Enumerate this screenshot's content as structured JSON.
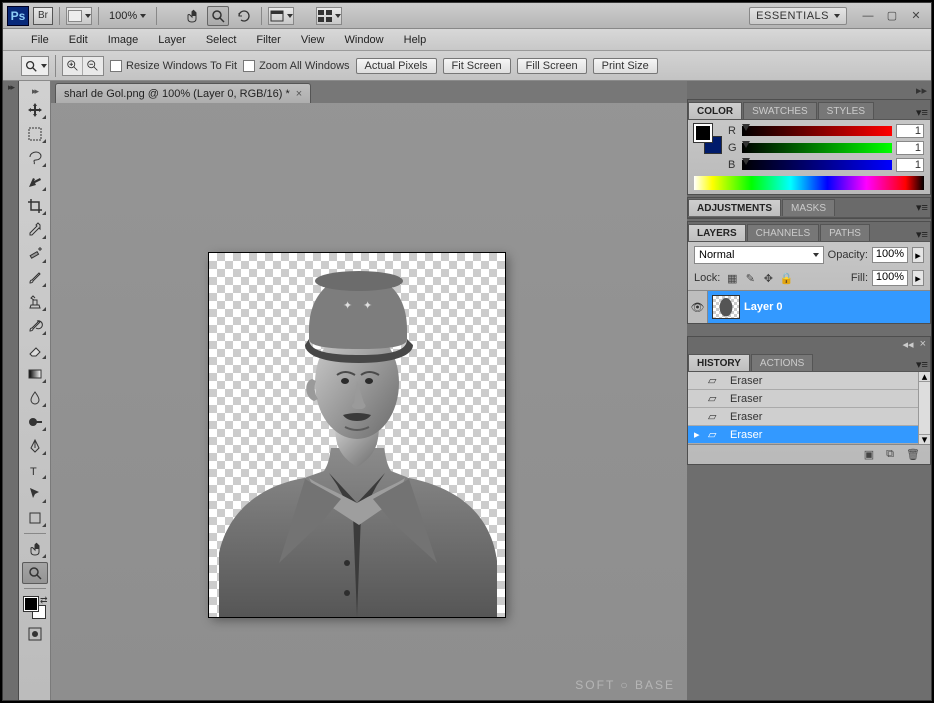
{
  "titlebar": {
    "ps_label": "Ps",
    "br_label": "Br",
    "zoom_value": "100%",
    "essentials_label": "ESSENTIALS"
  },
  "menu": {
    "items": [
      "File",
      "Edit",
      "Image",
      "Layer",
      "Select",
      "Filter",
      "View",
      "Window",
      "Help"
    ]
  },
  "optionsbar": {
    "resize_label": "Resize Windows To Fit",
    "zoom_all_label": "Zoom All Windows",
    "buttons": {
      "actual": "Actual Pixels",
      "fit": "Fit Screen",
      "fill": "Fill Screen",
      "print": "Print Size"
    }
  },
  "document": {
    "tab_title": "sharl de Gol.png @ 100% (Layer 0, RGB/16) *"
  },
  "panels": {
    "color": {
      "tab_color": "COLOR",
      "tab_swatches": "SWATCHES",
      "tab_styles": "STYLES",
      "r_label": "R",
      "g_label": "G",
      "b_label": "B",
      "r_value": "1",
      "g_value": "1",
      "b_value": "1"
    },
    "adjustments": {
      "tab_adjustments": "ADJUSTMENTS",
      "tab_masks": "MASKS"
    },
    "layers": {
      "tab_layers": "LAYERS",
      "tab_channels": "CHANNELS",
      "tab_paths": "PATHS",
      "blend_mode": "Normal",
      "opacity_label": "Opacity:",
      "opacity_value": "100%",
      "lock_label": "Lock:",
      "fill_label": "Fill:",
      "fill_value": "100%",
      "layer0_name": "Layer 0"
    },
    "history": {
      "tab_history": "HISTORY",
      "tab_actions": "ACTIONS",
      "rows": [
        "Eraser",
        "Eraser",
        "Eraser",
        "Eraser"
      ]
    }
  },
  "watermark": "SOFT ○ BASE"
}
